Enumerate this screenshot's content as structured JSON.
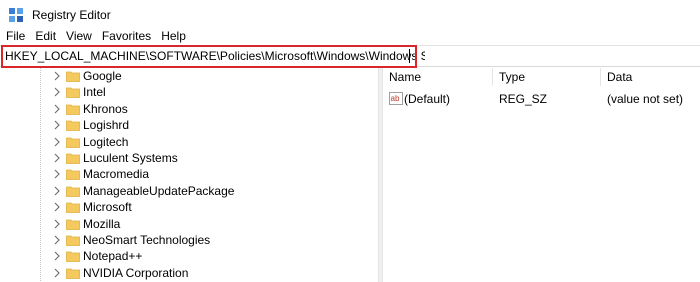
{
  "window": {
    "title": "Registry Editor"
  },
  "menu": [
    "File",
    "Edit",
    "View",
    "Favorites",
    "Help"
  ],
  "address": {
    "value": "HKEY_LOCAL_MACHINE\\SOFTWARE\\Policies\\Microsoft\\Windows\\Windows Search"
  },
  "tree": {
    "items": [
      {
        "label": "Google"
      },
      {
        "label": "Intel"
      },
      {
        "label": "Khronos"
      },
      {
        "label": "Logishrd"
      },
      {
        "label": "Logitech"
      },
      {
        "label": "Luculent Systems"
      },
      {
        "label": "Macromedia"
      },
      {
        "label": "ManageableUpdatePackage"
      },
      {
        "label": "Microsoft"
      },
      {
        "label": "Mozilla"
      },
      {
        "label": "NeoSmart Technologies"
      },
      {
        "label": "Notepad++"
      },
      {
        "label": "NVIDIA Corporation"
      }
    ]
  },
  "list": {
    "columns": [
      "Name",
      "Type",
      "Data"
    ],
    "rows": [
      {
        "name": "(Default)",
        "type": "REG_SZ",
        "data": "(value not set)",
        "icon": "string-value-icon"
      }
    ]
  },
  "colors": {
    "highlight": "#d9262b",
    "folder": "#f4c95d",
    "folder_dark": "#e0b040"
  }
}
